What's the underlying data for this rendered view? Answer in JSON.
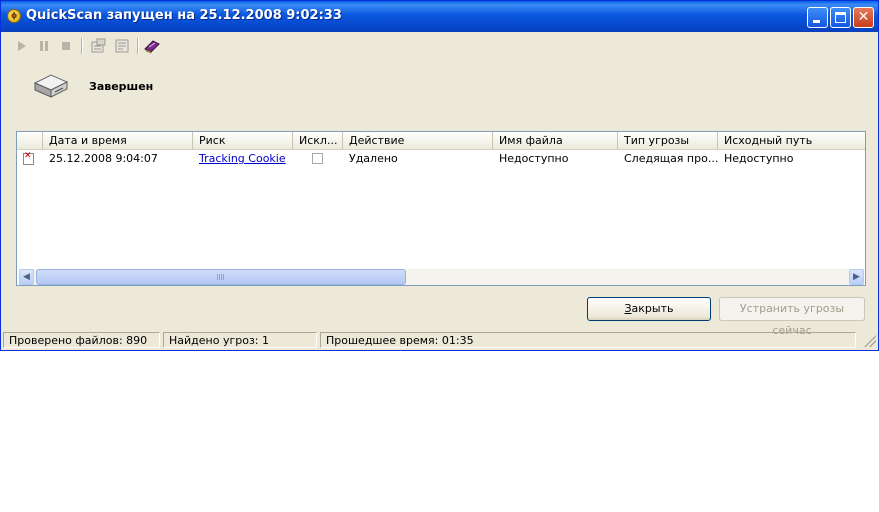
{
  "window": {
    "title": "QuickScan запущен на 25.12.2008 9:02:33",
    "controls": [
      "minimize",
      "maximize",
      "close"
    ]
  },
  "toolbar": {
    "buttons": [
      {
        "icon": "play-icon",
        "enabled": false
      },
      {
        "icon": "pause-icon",
        "enabled": false
      },
      {
        "icon": "stop-icon",
        "enabled": false
      },
      {
        "icon": "properties-icon",
        "enabled": false
      },
      {
        "icon": "export-icon",
        "enabled": false
      },
      {
        "icon": "book-icon",
        "enabled": true
      }
    ]
  },
  "status": {
    "icon": "disk-drive-icon",
    "text": "Завершен"
  },
  "results": {
    "columns": [
      "",
      "Дата и время",
      "Риск",
      "Искл...",
      "Действие",
      "Имя файла",
      "Тип угрозы",
      "Исходный путь"
    ],
    "rows": [
      {
        "icon": "threat-icon",
        "datetime": "25.12.2008 9:04:07",
        "risk": "Tracking Cookie",
        "excluded": false,
        "action": "Удалено",
        "filename": "Недоступно",
        "threat_type": "Следящая про...",
        "source_path": "Недоступно"
      }
    ]
  },
  "buttons": {
    "close_label_underlined": "З",
    "close_label_rest": "акрыть",
    "fix_label": "Устранить угрозы сейчас"
  },
  "statusbar": {
    "files_checked": "Проверено файлов: 890",
    "threats_found": "Найдено угроз: 1",
    "elapsed": "Прошедшее время:  01:35"
  },
  "colors": {
    "titlebar": "#0a5fea",
    "window_bg": "#ece9d8",
    "link": "#0000cc",
    "threat_mark": "#d00000"
  }
}
